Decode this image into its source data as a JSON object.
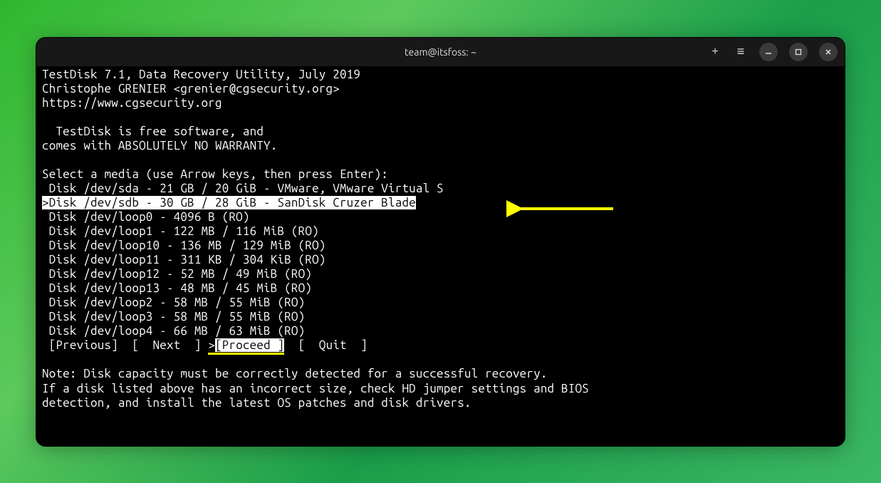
{
  "titlebar": {
    "title": "team@itsfoss: ~"
  },
  "header": {
    "line1": "TestDisk 7.1, Data Recovery Utility, July 2019",
    "line2": "Christophe GRENIER <grenier@cgsecurity.org>",
    "line3": "https://www.cgsecurity.org"
  },
  "intro": {
    "line1": "  TestDisk is free software, and",
    "line2": "comes with ABSOLUTELY NO WARRANTY."
  },
  "prompt": "Select a media (use Arrow keys, then press Enter):",
  "disks": [
    " Disk /dev/sda - 21 GB / 20 GiB - VMware, VMware Virtual S",
    ">Disk /dev/sdb - 30 GB / 28 GiB - SanDisk Cruzer Blade",
    " Disk /dev/loop0 - 4096 B (RO)",
    " Disk /dev/loop1 - 122 MB / 116 MiB (RO)",
    " Disk /dev/loop10 - 136 MB / 129 MiB (RO)",
    " Disk /dev/loop11 - 311 KB / 304 KiB (RO)",
    " Disk /dev/loop12 - 52 MB / 49 MiB (RO)",
    " Disk /dev/loop13 - 48 MB / 45 MiB (RO)",
    " Disk /dev/loop2 - 58 MB / 55 MiB (RO)",
    " Disk /dev/loop3 - 58 MB / 55 MiB (RO)",
    " Disk /dev/loop4 - 66 MB / 63 MiB (RO)"
  ],
  "selected_disk_index": 1,
  "menu": {
    "prefix": " ",
    "previous": "[Previous]",
    "gap1": "  ",
    "next": "[  Next  ]",
    "gap2": " ",
    "proceed_marker": ">",
    "proceed": "[Proceed ]",
    "gap3": "  ",
    "quit": "[  Quit  ]"
  },
  "note": {
    "line1": "Note: Disk capacity must be correctly detected for a successful recovery.",
    "line2": "If a disk listed above has an incorrect size, check HD jumper settings and BIOS",
    "line3": "detection, and install the latest OS patches and disk drivers."
  }
}
